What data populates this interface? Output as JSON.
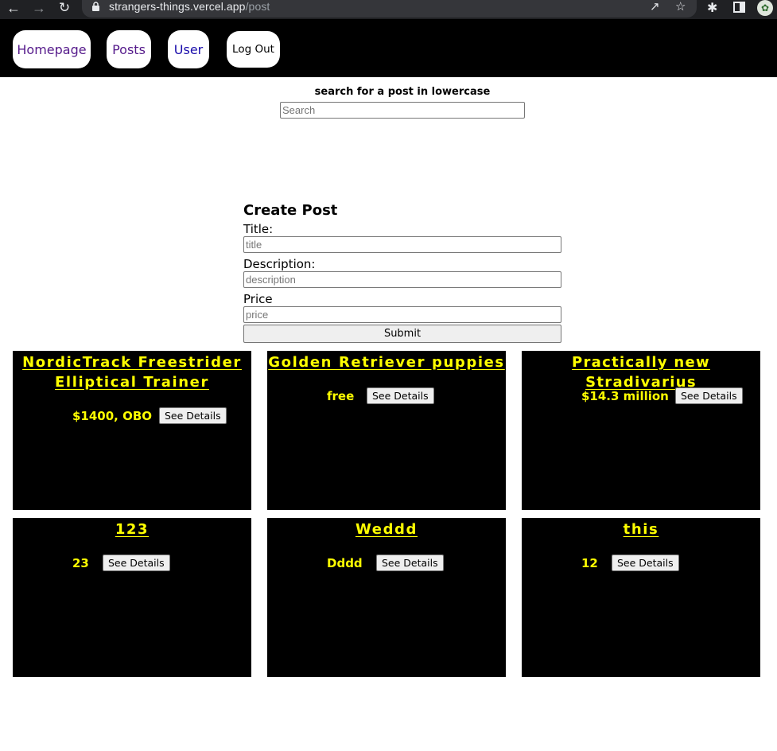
{
  "browser": {
    "url_host": "strangers-things.vercel.app",
    "url_path": "/post"
  },
  "nav": {
    "homepage": "Homepage",
    "posts": "Posts",
    "user": "User",
    "logout": "Log Out"
  },
  "search": {
    "label": "search for a post in lowercase",
    "placeholder": "Search"
  },
  "create_post": {
    "heading": "Create Post",
    "title_label": "Title:",
    "title_placeholder": "title",
    "description_label": "Description:",
    "description_placeholder": "description",
    "price_label": "Price",
    "price_placeholder": "price",
    "submit_label": "Submit"
  },
  "posts": [
    {
      "title": "NordicTrack Freestrider Elliptical Trainer",
      "price": "$1400, OBO",
      "button": "See Details"
    },
    {
      "title": "Golden Retriever puppies",
      "price": "free",
      "button": "See Details"
    },
    {
      "title": "Practically new Stradivarius",
      "price": "$14.3 million",
      "button": "See Details"
    },
    {
      "title": "123",
      "price": "23",
      "button": "See Details"
    },
    {
      "title": "Weddd",
      "price": "Dddd",
      "button": "See Details"
    },
    {
      "title": "this",
      "price": "12",
      "button": "See Details"
    }
  ],
  "colors": {
    "card_bg": "#000000",
    "card_text": "#ffff00",
    "navbar_bg": "#000000"
  }
}
